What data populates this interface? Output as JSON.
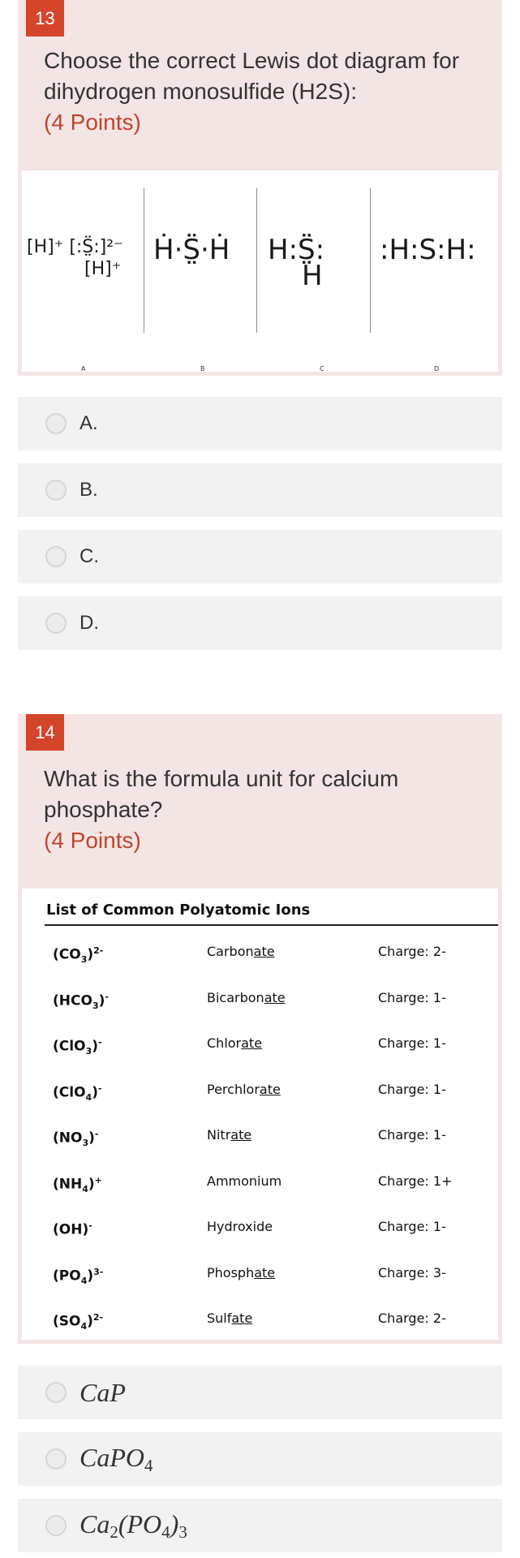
{
  "questions": [
    {
      "number": "13",
      "text": "Choose the correct Lewis dot diagram for dihydrogen monosulfide (H2S):",
      "points": "(4 Points)",
      "figure": {
        "captions": [
          "A",
          "B",
          "C",
          "D"
        ],
        "diagrams": {
          "a_line1": "[H]⁺ [:S̤̈:]²⁻",
          "a_line2": "[H]⁺",
          "b": "Ḣ·S̤̈·Ḣ",
          "c_line1": "H:S̤̈:",
          "c_line2": "H",
          "d": ":H:S:H:"
        }
      },
      "options": [
        "A.",
        "B.",
        "C.",
        "D."
      ]
    },
    {
      "number": "14",
      "text": "What is the formula unit for calcium phosphate?",
      "points": "(4 Points)",
      "table": {
        "title": "List of Common Polyatomic Ions",
        "rows": [
          {
            "ion": "(CO",
            "sub": "3",
            "close": ")",
            "sup": "2-",
            "name_pre": "Carbon",
            "name_u": "ate",
            "charge": "Charge: 2-"
          },
          {
            "ion": "(HCO",
            "sub": "3",
            "close": ")",
            "sup": "-",
            "name_pre": "Bicarbon",
            "name_u": "ate",
            "charge": "Charge: 1-"
          },
          {
            "ion": "(ClO",
            "sub": "3",
            "close": ")",
            "sup": "-",
            "name_pre": "Chlor",
            "name_u": "ate",
            "charge": "Charge: 1-"
          },
          {
            "ion": "(ClO",
            "sub": "4",
            "close": ")",
            "sup": "-",
            "name_pre": "Perchlor",
            "name_u": "ate",
            "charge": "Charge: 1-"
          },
          {
            "ion": "(NO",
            "sub": "3",
            "close": ")",
            "sup": "-",
            "name_pre": "Nitr",
            "name_u": "ate",
            "charge": "Charge: 1-"
          },
          {
            "ion": "(NH",
            "sub": "4",
            "close": ")",
            "sup": "+",
            "name_pre": "Ammonium",
            "name_u": "",
            "charge": "Charge: 1+"
          },
          {
            "ion": "(OH",
            "sub": "",
            "close": ")",
            "sup": "-",
            "name_pre": "Hydroxide",
            "name_u": "",
            "charge": "Charge: 1-"
          },
          {
            "ion": "(PO",
            "sub": "4",
            "close": ")",
            "sup": "3-",
            "name_pre": "Phosph",
            "name_u": "ate",
            "charge": "Charge: 3-"
          },
          {
            "ion": "(SO",
            "sub": "4",
            "close": ")",
            "sup": "2-",
            "name_pre": "Sulf",
            "name_u": "ate",
            "charge": "Charge: 2-"
          }
        ]
      },
      "options": [
        {
          "base": "CaP",
          "sub1": "",
          "mid": "",
          "sub2": ""
        },
        {
          "base": "CaPO",
          "sub1": "4",
          "mid": "",
          "sub2": ""
        },
        {
          "base": "Ca",
          "sub1": "2",
          "mid": "(PO",
          "sub2": "4",
          "tail": ")",
          "sub3": "3"
        }
      ]
    }
  ],
  "colors": {
    "accent": "#d5452b",
    "points": "#c0452e",
    "card_bg": "#f3e5e4",
    "option_bg": "#f2f2f2"
  }
}
